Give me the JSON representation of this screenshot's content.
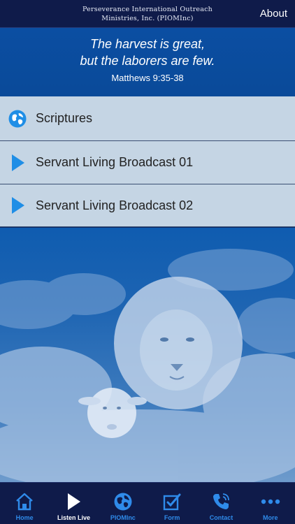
{
  "header": {
    "org_line1": "Perseverance International Outreach",
    "org_line2": "Ministries, Inc. (PIOMInc)",
    "about": "About"
  },
  "banner": {
    "quote": "The harvest is great,\nbut the laborers are few.",
    "reference": "Matthews 9:35-38"
  },
  "list": [
    {
      "label": "Scriptures",
      "icon": "globe-icon"
    },
    {
      "label": "Servant Living Broadcast 01",
      "icon": "play-icon"
    },
    {
      "label": "Servant Living Broadcast 02",
      "icon": "play-icon"
    }
  ],
  "tabs": [
    {
      "label": "Home",
      "icon": "home-icon"
    },
    {
      "label": "Listen Live",
      "icon": "play-icon",
      "active": true
    },
    {
      "label": "PIOMInc",
      "icon": "globe-icon"
    },
    {
      "label": "Form",
      "icon": "checkbox-icon"
    },
    {
      "label": "Contact",
      "icon": "phone-icon"
    },
    {
      "label": "More",
      "icon": "more-icon"
    }
  ],
  "colors": {
    "accent": "#2f8bea",
    "navbar": "#0f1b4a",
    "banner": "#0b4ea2",
    "row": "#c5d5e4"
  }
}
